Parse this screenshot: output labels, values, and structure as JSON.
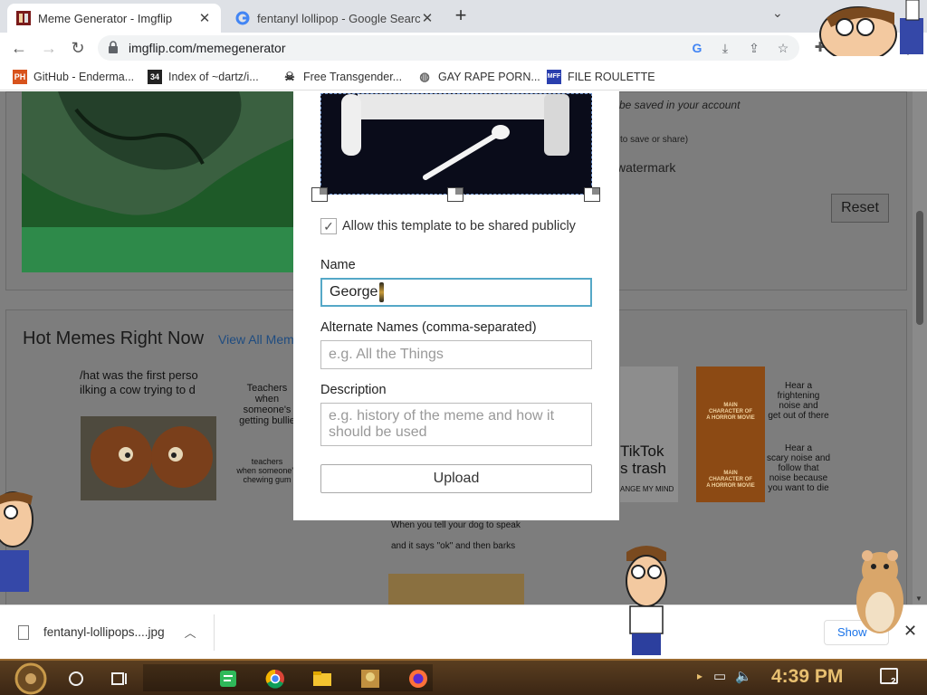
{
  "tabs": [
    {
      "title": "Meme Generator - Imgflip",
      "active": true
    },
    {
      "title": "fentanyl lollipop - Google Search",
      "active": false
    }
  ],
  "toolbar": {
    "url": "imgflip.com/memegenerator"
  },
  "bookmarks": [
    {
      "label": "GitHub - Enderma...",
      "icon": "PH"
    },
    {
      "label": "Index of ~dartz/i...",
      "icon": "34"
    },
    {
      "label": "Free Transgender...",
      "icon": "skull"
    },
    {
      "label": "GAY RAPE PORN...",
      "icon": "globe"
    },
    {
      "label": "FILE ROULETTE",
      "icon": "MFF"
    }
  ],
  "background": {
    "saved_text": "be saved in your account",
    "save_share_text": "to save or share)",
    "watermark_text": "watermark",
    "reset_label": "Reset",
    "hot_title": "Hot Memes Right Now",
    "hot_link": "View All Mem",
    "thumb1_text": "/hat was the first perso\nilking a cow trying to d",
    "thumb2_top": "Teachers\nwhen\nsomeone's\ngetting bullie",
    "thumb2_bottom": "teachers\nwhen someone's\nchewing gum",
    "thumb3_caption1": "When you tell your dog to speak",
    "thumb3_caption2": "and it says \"ok\" and then barks",
    "thumb4_text": "TikTok\ns trash",
    "thumb4_sub": "ANGE MY MIND",
    "thumb5_label": "MAIN\nCHARACTER OF\nA HORROR MOVIE",
    "thumb5_top": "Hear a\nfrightening\nnoise and\nget out of there",
    "thumb5_bottom": "Hear a\nscary noise and\nfollow that\nnoise because\nyou want to die"
  },
  "modal": {
    "share_checkbox_label": "Allow this template to be shared publicly",
    "share_checked": true,
    "name_label": "Name",
    "name_value": "George",
    "alt_label": "Alternate Names (comma-separated)",
    "alt_placeholder": "e.g. All the Things",
    "desc_label": "Description",
    "desc_placeholder": "e.g. history of the meme and how it should be used",
    "upload_label": "Upload"
  },
  "downloads": {
    "file_name": "fentanyl-lollipops....jpg",
    "show_all_label": "Show"
  },
  "taskbar": {
    "time": "4:39 PM",
    "notification_count": "2"
  },
  "colors": {
    "focus_border": "#55a8c7",
    "tab_bar": "#dee1e6",
    "page_overlay": "#7f7f7f"
  }
}
